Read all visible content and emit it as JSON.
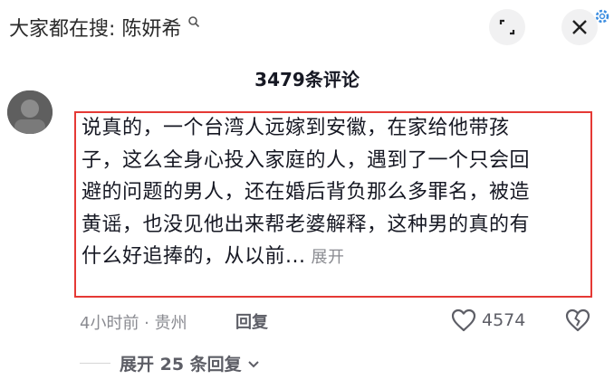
{
  "header": {
    "search_hint": "大家都在搜: 陈妍希",
    "search_icon": "search-icon",
    "expand_icon": "expand-icon",
    "close_icon": "close-icon",
    "watermark_icon": "settings-gear-icon"
  },
  "comments_count": "3479条评论",
  "comment": {
    "avatar_icon": "avatar",
    "lines": [
      "说真的，一个台湾人远嫁到安徽，在家给他带孩",
      "子，这么全身心投入家庭的人，遇到了一个只会回",
      "避的问题的男人，还在婚后背负那么多罪名，被造",
      "黄谣，也没见他出来帮老婆解释，这种男的真的有",
      "什么好追捧的，从以前..."
    ],
    "expand_label": "展开",
    "meta": "4小时前 · 贵州",
    "reply_label": "回复",
    "like_count": "4574",
    "replies_label": "展开 25 条回复"
  },
  "colors": {
    "highlight_border": "#e53935",
    "secondary_text": "#8a8b91",
    "primary_text": "#161823"
  }
}
